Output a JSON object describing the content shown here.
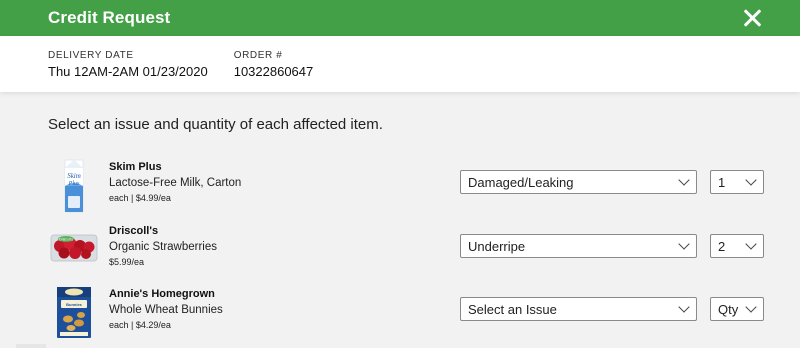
{
  "header": {
    "title": "Credit Request",
    "close_icon": "close-icon"
  },
  "order_info": {
    "delivery_label": "DELIVERY DATE",
    "delivery_value": "Thu 12AM-2AM 01/23/2020",
    "order_label": "ORDER #",
    "order_value": "10322860647"
  },
  "instruction": "Select an issue and quantity of each affected item.",
  "items": [
    {
      "brand": "Skim Plus",
      "name": "Lactose-Free Milk, Carton",
      "price": "each | $4.99/ea",
      "issue": "Damaged/Leaking",
      "qty": "1"
    },
    {
      "brand": "Driscoll's",
      "name": "Organic Strawberries",
      "price": "$5.99/ea",
      "issue": "Underripe",
      "qty": "2"
    },
    {
      "brand": "Annie's Homegrown",
      "name": "Whole Wheat Bunnies",
      "price": "each | $4.29/ea",
      "issue": "Select an Issue",
      "qty": "Qty"
    }
  ],
  "colors": {
    "header_green": "#43a047"
  }
}
